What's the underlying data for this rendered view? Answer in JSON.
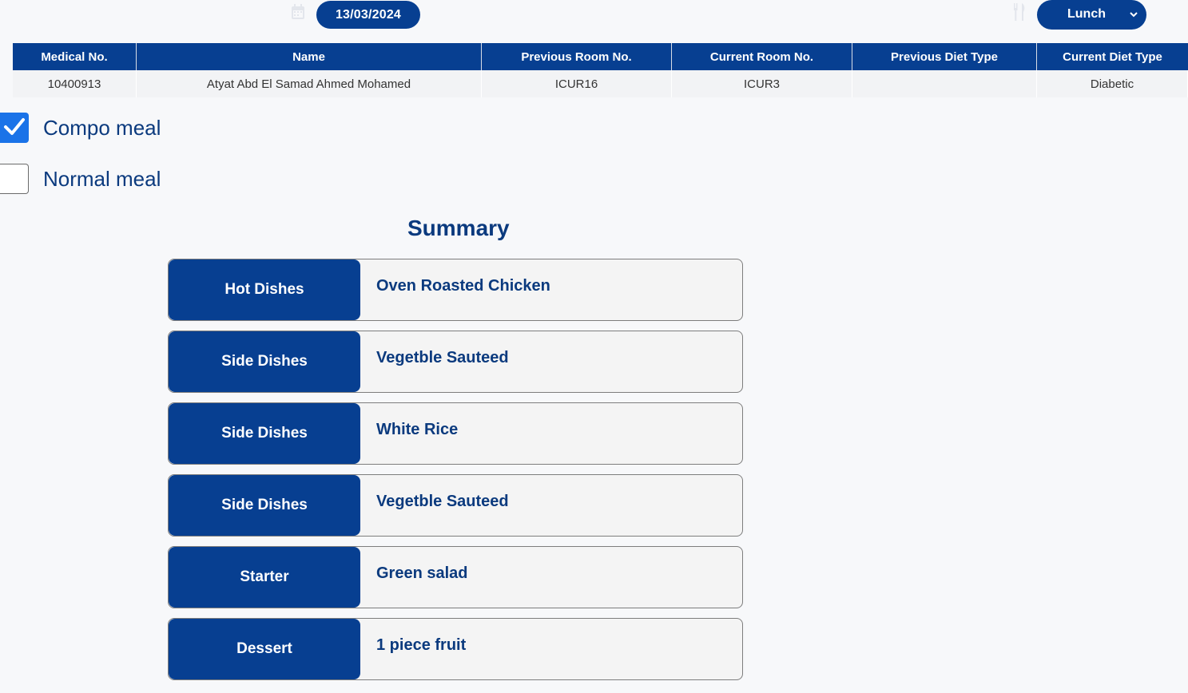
{
  "header": {
    "date": "13/03/2024",
    "meal_selected": "Lunch"
  },
  "table": {
    "columns": [
      "Medical No.",
      "Name",
      "Previous Room No.",
      "Current Room No.",
      "Previous Diet Type",
      "Current Diet Type"
    ],
    "rows": [
      [
        "10400913",
        "Atyat Abd El Samad Ahmed Mohamed",
        "ICUR16",
        "ICUR3",
        "",
        "Diabetic"
      ]
    ]
  },
  "options": {
    "compo_label": "Compo meal",
    "compo_checked": true,
    "normal_label": "Normal meal",
    "normal_checked": false
  },
  "summary": {
    "title": "Summary",
    "items": [
      {
        "category": "Hot Dishes",
        "dish": "Oven Roasted Chicken"
      },
      {
        "category": "Side Dishes",
        "dish": "Vegetble Sauteed"
      },
      {
        "category": "Side Dishes",
        "dish": "White Rice"
      },
      {
        "category": "Side Dishes",
        "dish": "Vegetble Sauteed"
      },
      {
        "category": "Starter",
        "dish": "Green salad"
      },
      {
        "category": "Dessert",
        "dish": "1 piece fruit"
      }
    ]
  },
  "colors": {
    "primary": "#073f91",
    "text_blue": "#0b3a7e",
    "check_blue": "#1a73e8"
  },
  "icons": {
    "date": "calendar-icon",
    "meal": "fork-knife-icon",
    "select": "chevron-down-icon",
    "check": "checkmark-icon"
  }
}
